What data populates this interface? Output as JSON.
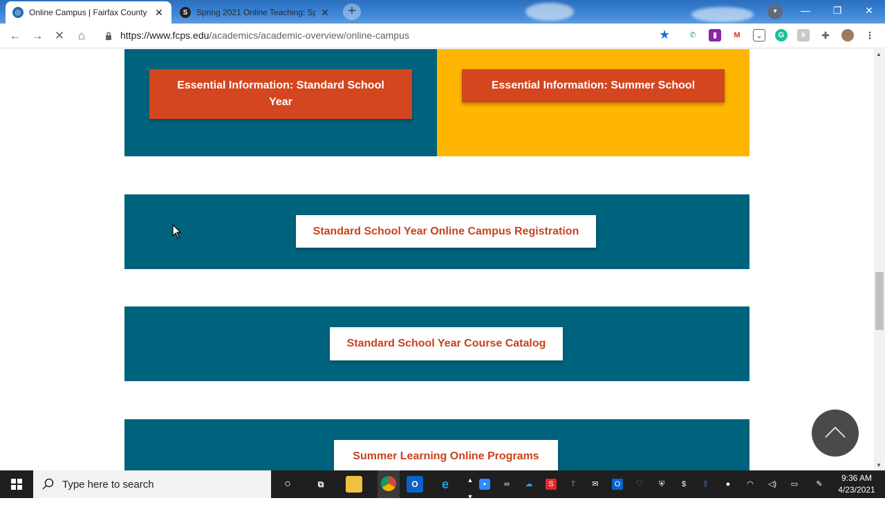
{
  "browser": {
    "tabs": [
      {
        "title": "Online Campus | Fairfax County P",
        "favicon": "fcps-logo-icon",
        "active": true
      },
      {
        "title": "Spring 2021 Online Teaching: Sp",
        "favicon": "screencastify-icon",
        "active": false
      }
    ],
    "new_tab": "+",
    "url_domain": "https://www.fcps.edu",
    "url_path": "/academics/academic-overview/online-campus"
  },
  "page": {
    "top_left_button": {
      "line1": "Essential Information: Standard School",
      "line2": "Year"
    },
    "top_right_button": "Essential Information: Summer School",
    "registration_button": "Standard School Year Online Campus Registration",
    "catalog_button": "Standard School Year Course Catalog",
    "summer_button": "Summer Learning Online Programs",
    "colors": {
      "teal": "#00637e",
      "gold": "#ffb600",
      "orange": "#d3461f",
      "link_text": "#c8421c"
    }
  },
  "taskbar": {
    "search_placeholder": "Type here to search",
    "time": "9:36 AM",
    "date": "4/23/2021"
  }
}
